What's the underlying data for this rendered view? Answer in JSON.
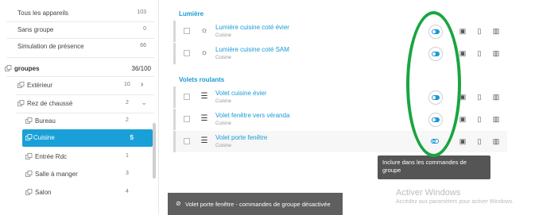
{
  "sidebar": {
    "top_items": [
      {
        "label": "Tous les appareils",
        "count": "103"
      },
      {
        "label": "Sans groupe",
        "count": "0"
      },
      {
        "label": "Simulation de présence",
        "count": "66"
      }
    ],
    "groups_header": {
      "label": "groupes",
      "count": "36/100"
    },
    "tree": [
      {
        "label": "Extérieur",
        "count": "10"
      },
      {
        "label": "Rez de chaussé",
        "count": "2"
      },
      {
        "label": "Bureau",
        "count": "2"
      },
      {
        "label": "Cuisine",
        "count": "5"
      },
      {
        "label": "Entrée Rdc",
        "count": "1"
      },
      {
        "label": "Salle à manger",
        "count": "3"
      },
      {
        "label": "Salon",
        "count": "4"
      }
    ]
  },
  "sections": [
    {
      "title": "Lumière",
      "devices": [
        {
          "name": "Lumière cuisine coté évier",
          "room": "Cuisine",
          "icon": "light-bulb-icon",
          "included": true
        },
        {
          "name": "Lumière cuisine coté SAM",
          "room": "Cuisine",
          "icon": "light-bulb-icon",
          "included": true
        }
      ]
    },
    {
      "title": "Volets roulants",
      "devices": [
        {
          "name": "Volet cuisine évier",
          "room": "Cuisine",
          "icon": "shutter-icon",
          "included": true
        },
        {
          "name": "Volet fenêtre vers véranda",
          "room": "Cuisine",
          "icon": "shutter-icon",
          "included": true
        },
        {
          "name": "Volet porte fenêtre",
          "room": "Cuisine",
          "icon": "shutter-icon",
          "included": false
        }
      ]
    }
  ],
  "tooltip": "Inclure dans les commandes de groupe",
  "toast": "Volet porte fenêtre - commandes de groupe désactivée",
  "watermark": {
    "title": "Activer Windows",
    "subtitle": "Accédez aux paramètres pour activer Windows."
  },
  "colors": {
    "accent": "#1a9ad6",
    "selected": "#1aa0d8",
    "annotation": "#19a540"
  }
}
